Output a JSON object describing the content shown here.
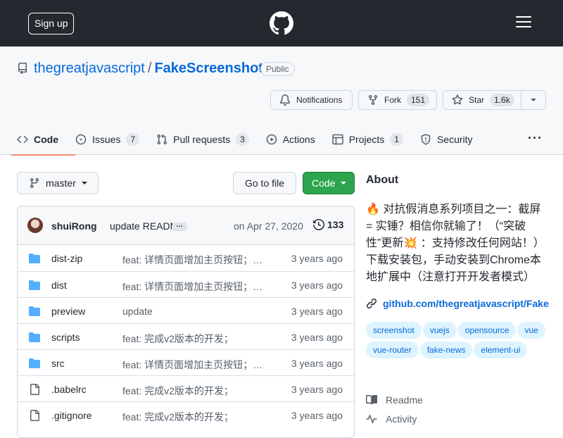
{
  "header": {
    "signup_label": "Sign up"
  },
  "repo": {
    "owner": "thegreatjavascript",
    "separator": "/",
    "name": "FakeScreenshot",
    "visibility": "Public"
  },
  "actions": {
    "notifications_label": "Notifications",
    "fork_label": "Fork",
    "fork_count": "151",
    "star_label": "Star",
    "star_count": "1.6k"
  },
  "tabs": [
    {
      "label": "Code",
      "count": null
    },
    {
      "label": "Issues",
      "count": "7"
    },
    {
      "label": "Pull requests",
      "count": "3"
    },
    {
      "label": "Actions",
      "count": null
    },
    {
      "label": "Projects",
      "count": "1"
    },
    {
      "label": "Security",
      "count": null
    }
  ],
  "more_menu": "···",
  "toolbar": {
    "branch": "master",
    "go_to_file": "Go to file",
    "code": "Code"
  },
  "commit": {
    "author": "shuiRong",
    "message": "update README",
    "ellipsis": "…",
    "date": "on Apr 27, 2020",
    "count": "133"
  },
  "files": [
    {
      "type": "dir",
      "name": "dist-zip",
      "message": "feat: 详情页面增加主页按钮；…",
      "time": "3 years ago"
    },
    {
      "type": "dir",
      "name": "dist",
      "message": "feat: 详情页面增加主页按钮；…",
      "time": "3 years ago"
    },
    {
      "type": "dir",
      "name": "preview",
      "message": "update",
      "time": "3 years ago"
    },
    {
      "type": "dir",
      "name": "scripts",
      "message": "feat: 完成v2版本的开发；",
      "time": "3 years ago"
    },
    {
      "type": "dir",
      "name": "src",
      "message": "feat: 详情页面增加主页按钮；…",
      "time": "3 years ago"
    },
    {
      "type": "file",
      "name": ".babelrc",
      "message": "feat: 完成v2版本的开发；",
      "time": "3 years ago"
    },
    {
      "type": "file",
      "name": ".gitignore",
      "message": "feat: 完成v2版本的开发；",
      "time": "3 years ago"
    }
  ],
  "about": {
    "title": "About",
    "description": "🔥 对抗假消息系列项目之一：截屏 = 实锤？相信你就输了！（“突破性”更新💥 ：支持修改任何网站！）下载安装包，手动安装到Chrome本地扩展中（注意打开开发者模式）",
    "link": "github.com/thegreatjavascript/FakeScreenshot",
    "topics": [
      "screenshot",
      "vuejs",
      "opensource",
      "vue",
      "vue-router",
      "fake-news",
      "element-ui"
    ],
    "readme": "Readme",
    "activity": "Activity"
  },
  "colors": {
    "header_bg": "#24292f",
    "link": "#0969da",
    "primary_btn": "#2da44e",
    "active_tab_underline": "#fd8c73",
    "folder": "#54aeff"
  }
}
